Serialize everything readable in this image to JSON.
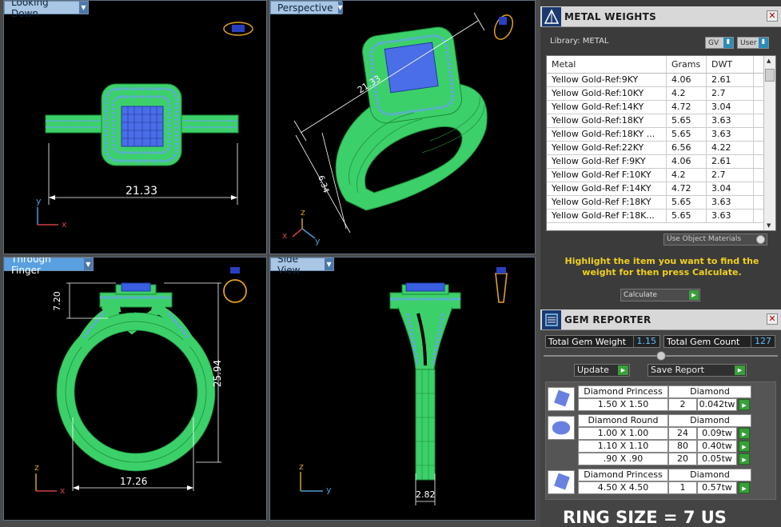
{
  "viewports": {
    "top_left": {
      "label": "Looking Down",
      "dimension": "21.33"
    },
    "top_right": {
      "label": "Perspective",
      "dimension_a": "21.33",
      "dimension_b": "6.34"
    },
    "bottom_left": {
      "label": "Through Finger",
      "dim_height_top": "7.20",
      "dim_height_total": "25.94",
      "dim_inner": "17.26"
    },
    "bottom_right": {
      "label": "Side View",
      "dim_width": "2.82"
    },
    "axes": {
      "x": "x",
      "y": "y",
      "z": "z"
    }
  },
  "metal_weights": {
    "title": "METAL WEIGHTS",
    "library_label": "Library: METAL",
    "toggle_gv": "GV",
    "toggle_user": "User",
    "columns": [
      "Metal",
      "Grams",
      "DWT"
    ],
    "rows": [
      [
        "Yellow Gold-Ref:9KY",
        "4.06",
        "2.61"
      ],
      [
        "Yellow Gold-Ref:10KY",
        "4.2",
        "2.7"
      ],
      [
        "Yellow Gold-Ref:14KY",
        "4.72",
        "3.04"
      ],
      [
        "Yellow Gold-Ref:18KY",
        "5.65",
        "3.63"
      ],
      [
        "Yellow Gold-Ref:18KY ...",
        "5.65",
        "3.63"
      ],
      [
        "Yellow Gold-Ref:22KY",
        "6.56",
        "4.22"
      ],
      [
        "Yellow Gold-Ref F:9KY",
        "4.06",
        "2.61"
      ],
      [
        "Yellow Gold-Ref F:10KY",
        "4.2",
        "2.7"
      ],
      [
        "Yellow Gold-Ref F:14KY",
        "4.72",
        "3.04"
      ],
      [
        "Yellow Gold-Ref F:18KY",
        "5.65",
        "3.63"
      ],
      [
        "Yellow Gold-Ref F:18K...",
        "5.65",
        "3.63"
      ]
    ],
    "use_object_materials": "Use Object Materials",
    "hint": "Highlight the item you want to find the weight for then press Calculate.",
    "calculate_label": "Calculate"
  },
  "gem_reporter": {
    "title": "GEM REPORTER",
    "total_weight_label": "Total Gem Weight",
    "total_weight_value": "1.15",
    "total_count_label": "Total Gem Count",
    "total_count_value": "127",
    "update_label": "Update",
    "save_report_label": "Save Report",
    "groups": [
      {
        "shape": "Diamond Princess",
        "material": "Diamond",
        "rows": [
          {
            "size": "1.50 X 1.50",
            "count": "2",
            "weight": "0.042tw"
          }
        ]
      },
      {
        "shape": "Diamond Round",
        "material": "Diamond",
        "rows": [
          {
            "size": "1.00 X 1.00",
            "count": "24",
            "weight": "0.09tw"
          },
          {
            "size": "1.10 X 1.10",
            "count": "80",
            "weight": "0.40tw"
          },
          {
            "size": ".90 X .90",
            "count": "20",
            "weight": "0.05tw"
          }
        ]
      },
      {
        "shape": "Diamond Princess",
        "material": "Diamond",
        "rows": [
          {
            "size": "4.50 X 4.50",
            "count": "1",
            "weight": "0.57tw"
          }
        ]
      }
    ],
    "ring_size": "RING SIZE = 7 US"
  }
}
